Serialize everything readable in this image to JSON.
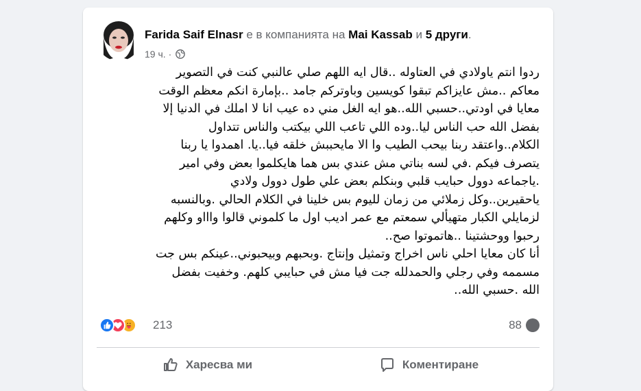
{
  "post": {
    "author": "Farida Saif Elnasr",
    "with_text": "е в компанията на",
    "tagged_person": "Mai Kassab",
    "and_text": "и",
    "others": "5 други",
    "period": ".",
    "time": "19 ч.",
    "separator": "·",
    "privacy_icon": "globe-icon",
    "text_lines": [
      "ردوا انتم ياولادي في العتاوله ..قال ايه اللهم صلي عالنبي كنت في التصوير",
      "معاكم ..مش عايزاكم تبقوا كويسين وباوتركم جامد ..بإمارة انكم معظم الوقت",
      "معايا في اودتي..حسبي الله..هو ايه الغل مني ده عيب انا لا املك في الدنيا إلا",
      "بفضل الله حب الناس ليا..وده اللي تاعب اللي بيكتب والناس تتداول",
      "الكلام..واعتقد ربنا بيحب الطيب وا الا مايحببش خلقه فيا..يا. اهمدوا يا ربنا",
      "يتصرف فيكم .في لسه بناتي مش عندي بس هما هايكلموا بعض وفي امير",
      ".ياجماعه دوول حبايب قلبي وبنكلم بعض علي طول دوول ولادي",
      "ياحقيرين..وكل زملائي من زمان لليوم بس خلينا في الكلام الحالي .وبالنسبه",
      "لزمايلي الكبار متهيألي سمعتم مع عمر اديب اول ما كلموني قالوا واااو وكلهم",
      "رحبوا ووحشتينا ..هاتموتوا صح..",
      "أنا كان معايا احلي ناس اخراج وتمثيل وإنتاج .وبحبهم وبيحبوني..عينكم بس جت",
      "مسممه وفي رجلي والحمدلله جت فيا مش في حبايبي كلهم. وخفيت بفضل",
      "الله .حسبي الله.."
    ]
  },
  "reactions": {
    "icons": [
      "like-icon",
      "love-icon",
      "care-icon"
    ],
    "count": "213",
    "comments_count": "88"
  },
  "actions": {
    "like_label": "Харесва ми",
    "comment_label": "Коментиране"
  },
  "colors": {
    "like": "#1877f2",
    "love": "#f33e58",
    "care": "#f7b125",
    "secondary_text": "#65676b"
  }
}
